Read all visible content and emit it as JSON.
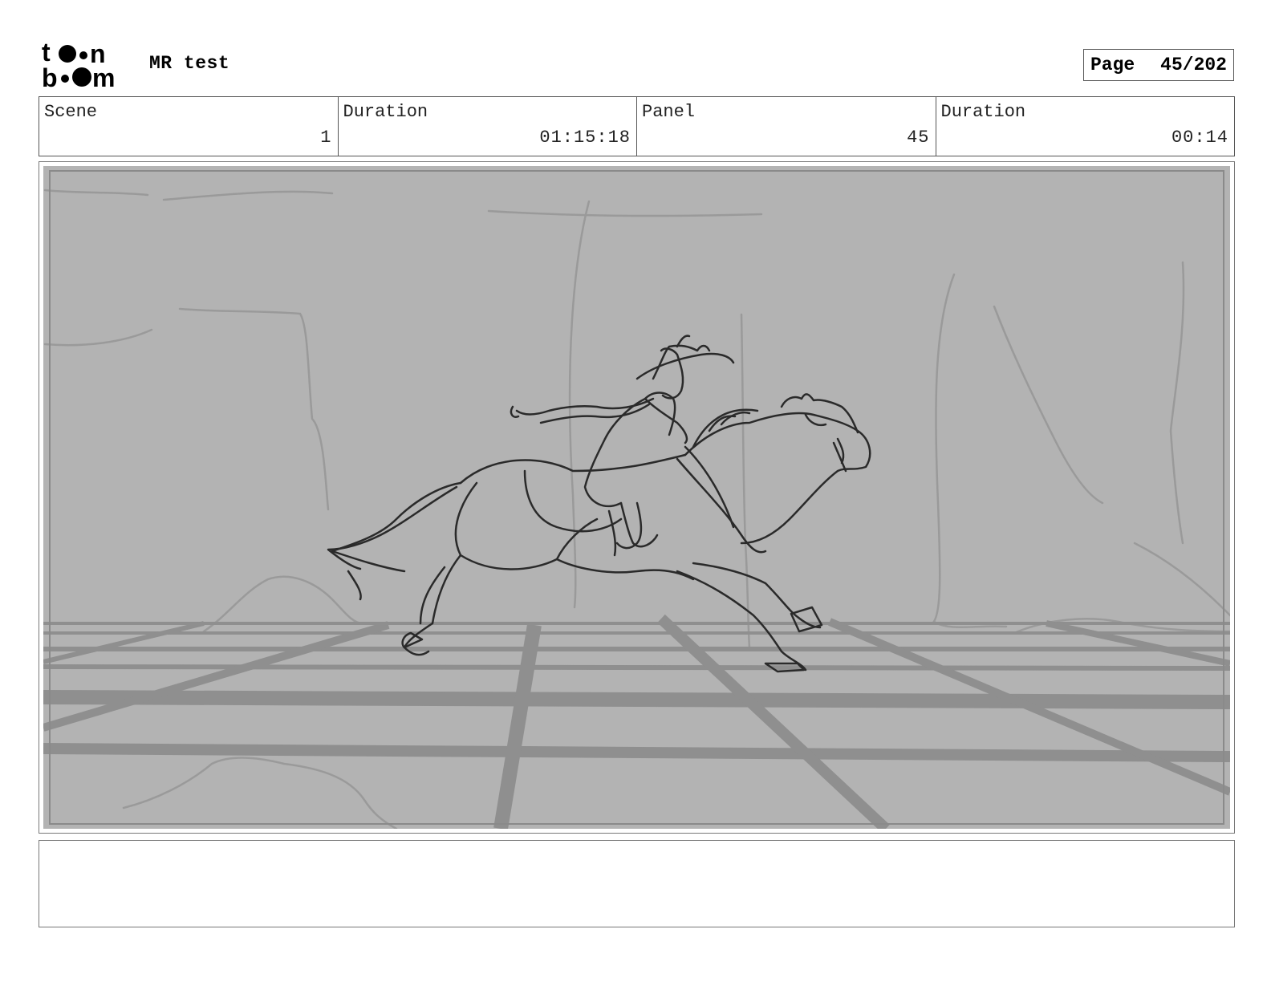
{
  "header": {
    "logo_text": "toon boom",
    "project_title": "MR test",
    "page_label": "Page",
    "page_value": "45/202"
  },
  "info": [
    {
      "label": "Scene",
      "value": "1"
    },
    {
      "label": "Duration",
      "value": "01:15:18"
    },
    {
      "label": "Panel",
      "value": "45"
    },
    {
      "label": "Duration",
      "value": "00:14"
    }
  ],
  "panel": {
    "background_color": "#b3b3b3",
    "grid_color": "#8f8f8f",
    "sketch_color": "#2a2a2a"
  },
  "notes": {
    "text": ""
  }
}
